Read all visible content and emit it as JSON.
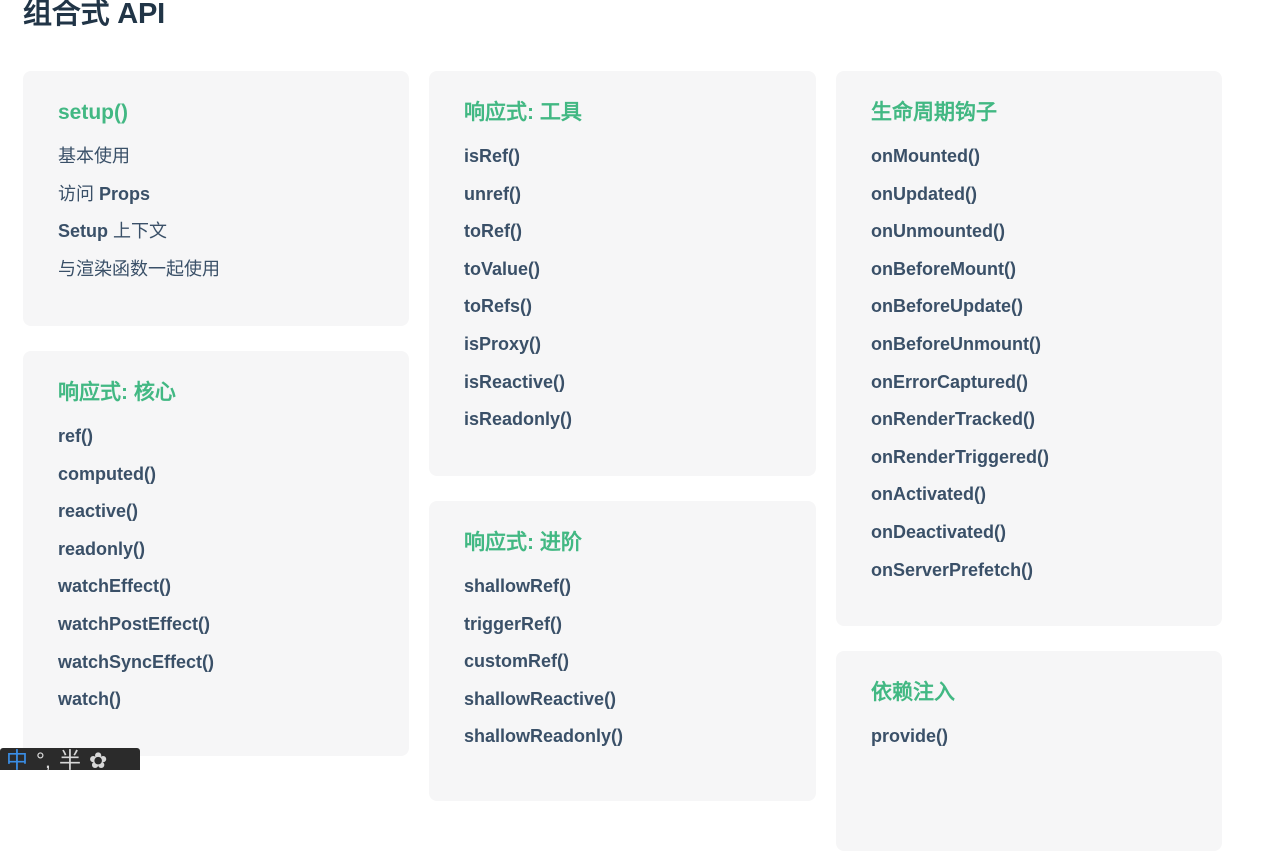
{
  "page": {
    "title": "组合式 API"
  },
  "cards": {
    "setup": {
      "title": "setup()",
      "items": [
        {
          "text": "基本使用"
        },
        {
          "pre": "访问 ",
          "strong": "Props"
        },
        {
          "strong": "Setup",
          "post": " 上下文"
        },
        {
          "text": "与渲染函数一起使用"
        }
      ]
    },
    "core": {
      "title": "响应式: 核心",
      "items": [
        "ref()",
        "computed()",
        "reactive()",
        "readonly()",
        "watchEffect()",
        "watchPostEffect()",
        "watchSyncEffect()",
        "watch()"
      ]
    },
    "utils": {
      "title": "响应式: 工具",
      "items": [
        "isRef()",
        "unref()",
        "toRef()",
        "toValue()",
        "toRefs()",
        "isProxy()",
        "isReactive()",
        "isReadonly()"
      ]
    },
    "advanced": {
      "title": "响应式: 进阶",
      "items": [
        "shallowRef()",
        "triggerRef()",
        "customRef()",
        "shallowReactive()",
        "shallowReadonly()"
      ]
    },
    "lifecycle": {
      "title": "生命周期钩子",
      "items": [
        "onMounted()",
        "onUpdated()",
        "onUnmounted()",
        "onBeforeMount()",
        "onBeforeUpdate()",
        "onBeforeUnmount()",
        "onErrorCaptured()",
        "onRenderTracked()",
        "onRenderTriggered()",
        "onActivated()",
        "onDeactivated()",
        "onServerPrefetch()"
      ]
    },
    "di": {
      "title": "依赖注入",
      "items": [
        "provide()"
      ]
    }
  },
  "ime": {
    "mode": "中",
    "punct": "°,",
    "width": "半",
    "skin": "✿"
  },
  "colors": {
    "accent": "#42b883",
    "link": "#3a5068",
    "card_bg": "#f6f6f7",
    "title": "#213547"
  }
}
